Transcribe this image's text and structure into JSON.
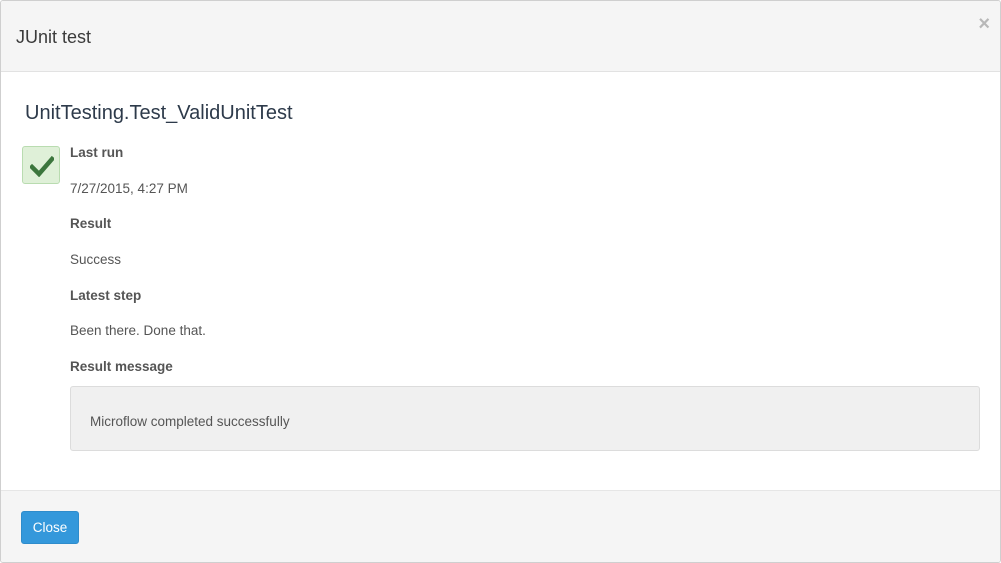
{
  "dialog": {
    "title": "JUnit test",
    "close_icon_glyph": "×"
  },
  "test": {
    "name": "UnitTesting.Test_ValidUnitTest",
    "status_icon": "checkmark-icon",
    "status_color": "#3c763d"
  },
  "fields": {
    "last_run_label": "Last run",
    "last_run_value": "7/27/2015, 4:27 PM",
    "result_label": "Result",
    "result_value": "Success",
    "latest_step_label": "Latest step",
    "latest_step_value": "Been there. Done that.",
    "result_message_label": "Result message",
    "result_message_value": "Microflow completed successfully"
  },
  "footer": {
    "close_button_label": "Close",
    "accent_color": "#3498db"
  }
}
